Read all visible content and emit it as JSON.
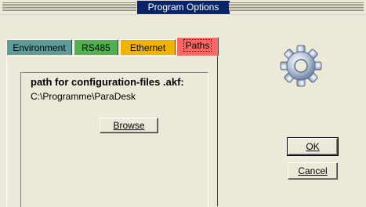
{
  "window": {
    "title": "Program Options"
  },
  "tabs": [
    {
      "label": "Environment"
    },
    {
      "label": "RS485"
    },
    {
      "label": "Ethernet"
    },
    {
      "label": "Paths",
      "selected": true
    }
  ],
  "paths_panel": {
    "heading": "path for configuration-files .akf:",
    "path": "C:\\Programme\\ParaDesk",
    "browse_label": "Browse"
  },
  "buttons": {
    "ok_label": "OK",
    "cancel_label": "Cancel"
  },
  "icons": {
    "settings": "gear-icon"
  },
  "colors": {
    "tab_environment": "#5e9c9c",
    "tab_rs485": "#4fb24f",
    "tab_ethernet": "#f0b400",
    "tab_paths": "#fb6767",
    "title_highlight": "#0a246a"
  }
}
